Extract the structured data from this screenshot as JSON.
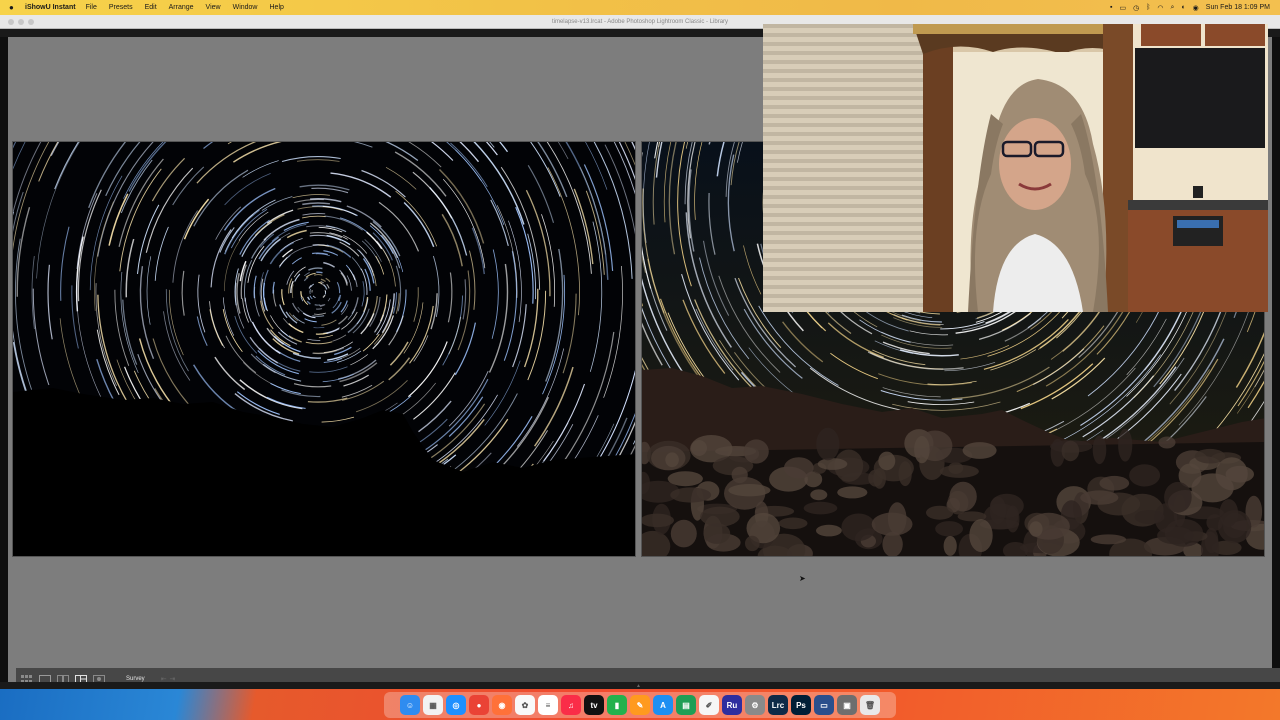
{
  "menubar": {
    "app_name": "iShowU Instant",
    "menus": [
      "File",
      "Presets",
      "Edit",
      "Arrange",
      "View",
      "Window",
      "Help"
    ],
    "clock": "Sun Feb 18  1:09 PM"
  },
  "window": {
    "title": "timelapse-v13.lrcat - Adobe Photoshop Lightroom Classic - Library"
  },
  "toolbar": {
    "mode_label": "Survey",
    "view_modes": [
      "grid-view-icon",
      "loupe-view-icon",
      "compare-view-icon",
      "survey-view-icon",
      "people-view-icon"
    ]
  },
  "dock": {
    "icons": [
      {
        "name": "finder-icon",
        "color": "#2f8cf0",
        "glyph": "☺"
      },
      {
        "name": "launchpad-icon",
        "color": "#f2f2f2",
        "glyph": "▦"
      },
      {
        "name": "safari-icon",
        "color": "#1e90ff",
        "glyph": "◎"
      },
      {
        "name": "chrome-icon",
        "color": "#ea4335",
        "glyph": "●"
      },
      {
        "name": "firefox-icon",
        "color": "#ff7139",
        "glyph": "◉"
      },
      {
        "name": "photos-icon",
        "color": "#f9f9f9",
        "glyph": "✿"
      },
      {
        "name": "notes-icon",
        "color": "#ffffff",
        "glyph": "≡"
      },
      {
        "name": "music-icon",
        "color": "#fa2d48",
        "glyph": "♫"
      },
      {
        "name": "tv-icon",
        "color": "#111111",
        "glyph": "tv"
      },
      {
        "name": "numbers-icon",
        "color": "#23b14d",
        "glyph": "▮"
      },
      {
        "name": "pages-icon",
        "color": "#ff9a1f",
        "glyph": "✎"
      },
      {
        "name": "app-store-icon",
        "color": "#1d8ff2",
        "glyph": "A"
      },
      {
        "name": "spreadsheet-icon",
        "color": "#1f9e55",
        "glyph": "▤"
      },
      {
        "name": "pencil-app-icon",
        "color": "#f6f6f6",
        "glyph": "✐"
      },
      {
        "name": "ru-app-icon",
        "color": "#2e2e9f",
        "glyph": "Ru"
      },
      {
        "name": "system-preferences-icon",
        "color": "#8a8a8a",
        "glyph": "⚙"
      },
      {
        "name": "lightroom-classic-icon",
        "color": "#0e2a47",
        "glyph": "Lrc"
      },
      {
        "name": "photoshop-icon",
        "color": "#001e36",
        "glyph": "Ps"
      },
      {
        "name": "lightroom-window-icon",
        "color": "#2b4f8c",
        "glyph": "▭"
      },
      {
        "name": "preview-icon",
        "color": "#6e6e6e",
        "glyph": "▣"
      },
      {
        "name": "trash-icon",
        "color": "#e9e9e9",
        "glyph": "🗑"
      }
    ]
  },
  "colors": {
    "menubar": "#f2c247",
    "viewer_bg": "#7d7d7d",
    "toolbar_bg": "#474747"
  }
}
